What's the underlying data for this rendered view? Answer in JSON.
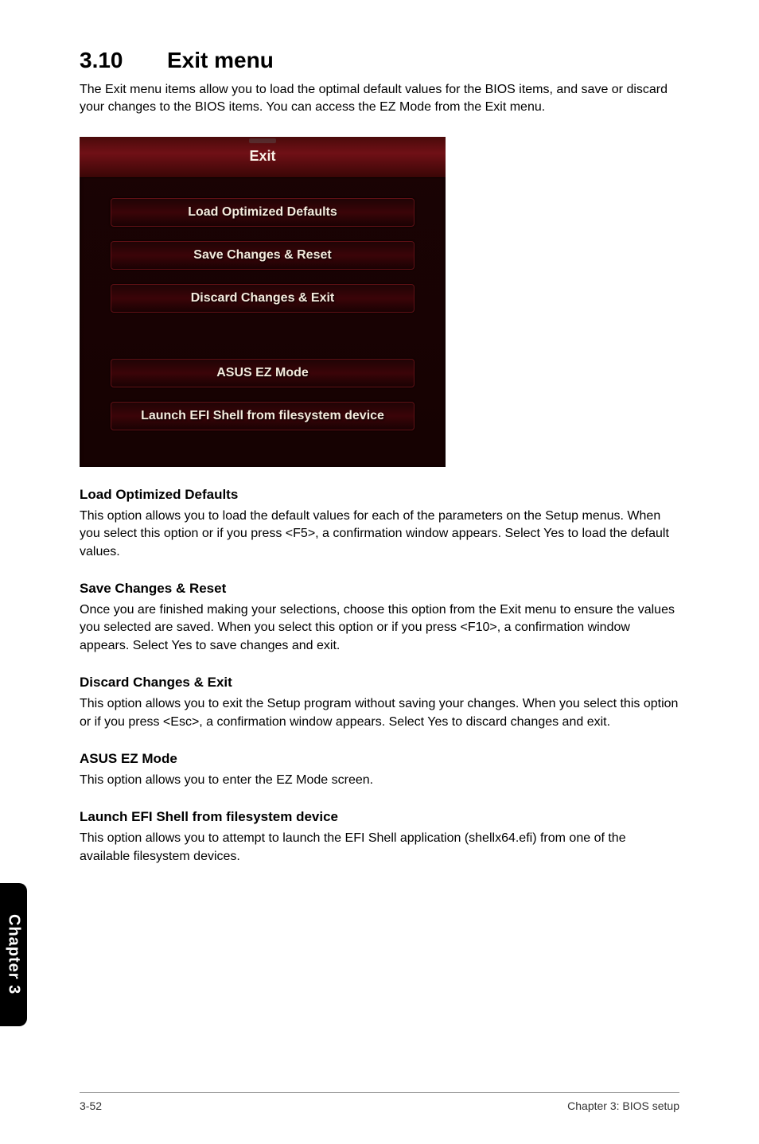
{
  "section": {
    "number": "3.10",
    "title": "Exit menu",
    "intro": "The Exit menu items allow you to load the optimal default values for the BIOS items, and save or discard your changes to the BIOS items. You can access the EZ Mode from the Exit menu."
  },
  "bios": {
    "header": "Exit",
    "buttons_top": [
      "Load Optimized Defaults",
      "Save Changes & Reset",
      "Discard Changes & Exit"
    ],
    "buttons_bottom": [
      "ASUS EZ Mode",
      "Launch EFI Shell from filesystem device"
    ]
  },
  "subsections": [
    {
      "heading": "Load Optimized Defaults",
      "text": "This option allows you to load the default values for each of the parameters on the Setup menus. When you select this option or if you press <F5>, a confirmation window appears. Select Yes to load the default values."
    },
    {
      "heading": "Save Changes & Reset",
      "text": "Once you are finished making your selections, choose this option from the Exit menu to ensure the values you selected are saved. When you select this option or if you press <F10>, a confirmation window appears. Select Yes to save changes and exit."
    },
    {
      "heading": "Discard Changes & Exit",
      "text": "This option allows you to exit the Setup program without saving your changes. When you select this option or if you press <Esc>, a confirmation window appears. Select Yes to discard changes and exit."
    },
    {
      "heading": "ASUS EZ Mode",
      "text": "This option allows you to enter the EZ Mode screen."
    },
    {
      "heading": "Launch EFI Shell from filesystem device",
      "text": "This option allows you to attempt to launch the EFI Shell application (shellx64.efi) from one of the available filesystem devices."
    }
  ],
  "side_tab": "Chapter 3",
  "footer": {
    "left": "3-52",
    "right": "Chapter 3: BIOS setup"
  }
}
